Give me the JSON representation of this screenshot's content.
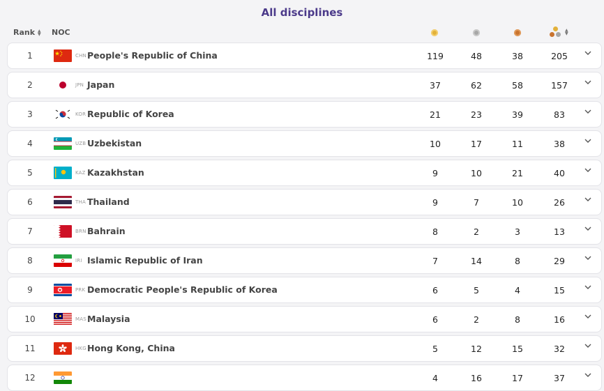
{
  "page_title": "All disciplines",
  "header": {
    "rank": "Rank",
    "noc": "NOC"
  },
  "rows": [
    {
      "rank": "1",
      "code": "CHN",
      "name": "People's Republic of China",
      "gold": "119",
      "silver": "48",
      "bronze": "38",
      "total": "205",
      "flag": "china"
    },
    {
      "rank": "2",
      "code": "JPN",
      "name": "Japan",
      "gold": "37",
      "silver": "62",
      "bronze": "58",
      "total": "157",
      "flag": "japan"
    },
    {
      "rank": "3",
      "code": "KOR",
      "name": "Republic of Korea",
      "gold": "21",
      "silver": "23",
      "bronze": "39",
      "total": "83",
      "flag": "korea"
    },
    {
      "rank": "4",
      "code": "UZB",
      "name": "Uzbekistan",
      "gold": "10",
      "silver": "17",
      "bronze": "11",
      "total": "38",
      "flag": "uzbekistan"
    },
    {
      "rank": "5",
      "code": "KAZ",
      "name": "Kazakhstan",
      "gold": "9",
      "silver": "10",
      "bronze": "21",
      "total": "40",
      "flag": "kazakhstan"
    },
    {
      "rank": "6",
      "code": "THA",
      "name": "Thailand",
      "gold": "9",
      "silver": "7",
      "bronze": "10",
      "total": "26",
      "flag": "thailand"
    },
    {
      "rank": "7",
      "code": "BRN",
      "name": "Bahrain",
      "gold": "8",
      "silver": "2",
      "bronze": "3",
      "total": "13",
      "flag": "bahrain"
    },
    {
      "rank": "8",
      "code": "IRI",
      "name": "Islamic Republic of Iran",
      "gold": "7",
      "silver": "14",
      "bronze": "8",
      "total": "29",
      "flag": "iran"
    },
    {
      "rank": "9",
      "code": "PRK",
      "name": "Democratic People's Republic of Korea",
      "gold": "6",
      "silver": "5",
      "bronze": "4",
      "total": "15",
      "flag": "dprk"
    },
    {
      "rank": "10",
      "code": "MAS",
      "name": "Malaysia",
      "gold": "6",
      "silver": "2",
      "bronze": "8",
      "total": "16",
      "flag": "malaysia"
    },
    {
      "rank": "11",
      "code": "HKG",
      "name": "Hong Kong, China",
      "gold": "5",
      "silver": "12",
      "bronze": "15",
      "total": "32",
      "flag": "hongkong"
    },
    {
      "rank": "12",
      "code": "",
      "name": "",
      "gold": "4",
      "silver": "16",
      "bronze": "17",
      "total": "37",
      "flag": "india"
    }
  ],
  "colors": {
    "title": "#4b3a8a",
    "gold": "#e2b13a",
    "silver": "#a7a7a7",
    "bronze": "#c9742f"
  }
}
